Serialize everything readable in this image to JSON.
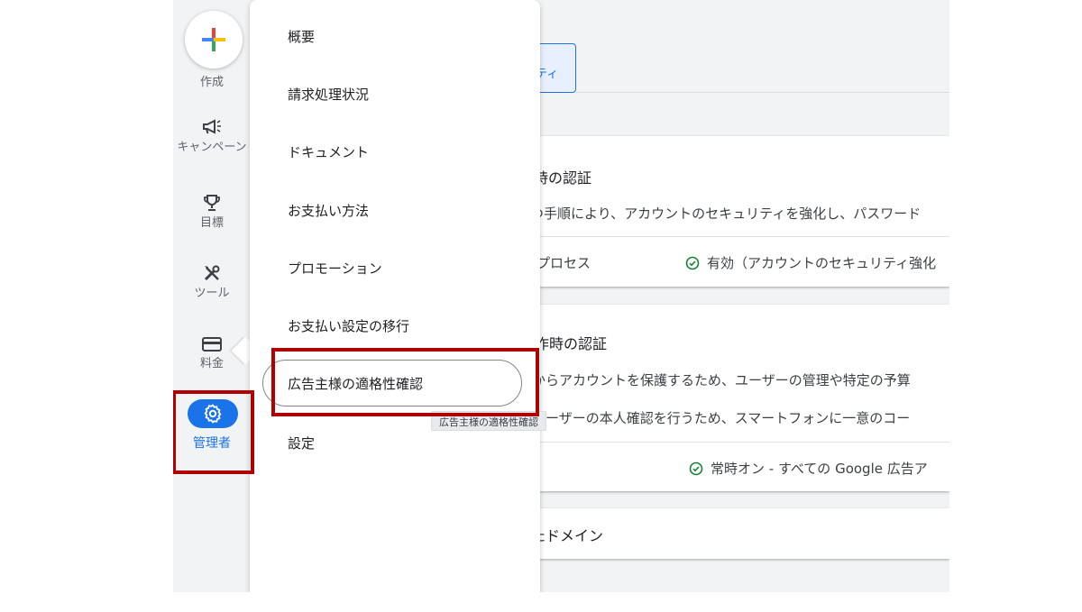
{
  "rail": {
    "create_label": "作成",
    "items": [
      {
        "label": "キャンペーン",
        "icon": "megaphone-icon"
      },
      {
        "label": "目標",
        "icon": "trophy-icon"
      },
      {
        "label": "ツール",
        "icon": "tools-icon"
      },
      {
        "label": "料金",
        "icon": "credit-card-icon"
      }
    ],
    "admin_label": "管理者"
  },
  "menu": {
    "items": [
      "概要",
      "請求処理状況",
      "ドキュメント",
      "お支払い方法",
      "プロモーション",
      "お支払い設定の移行"
    ],
    "active_item": "広告主様の適格性確認",
    "tooltip": "広告主様の適格性確認",
    "last_item": "設定"
  },
  "content": {
    "chip_label": "ティ",
    "card1": {
      "title": "時の認証",
      "desc": "つ手順により、アカウントのセキュリティを強化し、パスワード",
      "row_label": "プロセス",
      "row_status": "有効（アカウントのセキュリティ強化"
    },
    "card2": {
      "title": "作時の認証",
      "desc1": "からアカウントを保護するため、ユーザーの管理や特定の予算",
      "desc2": "ユーザーの本人確認を行うため、スマートフォンに一意のコー",
      "row_status": "常時オン - すべての Google 広告ア"
    },
    "card3": {
      "title": "たドメイン"
    }
  },
  "colors": {
    "accent": "#1a73e8",
    "highlight": "#b00000",
    "success": "#188038"
  }
}
